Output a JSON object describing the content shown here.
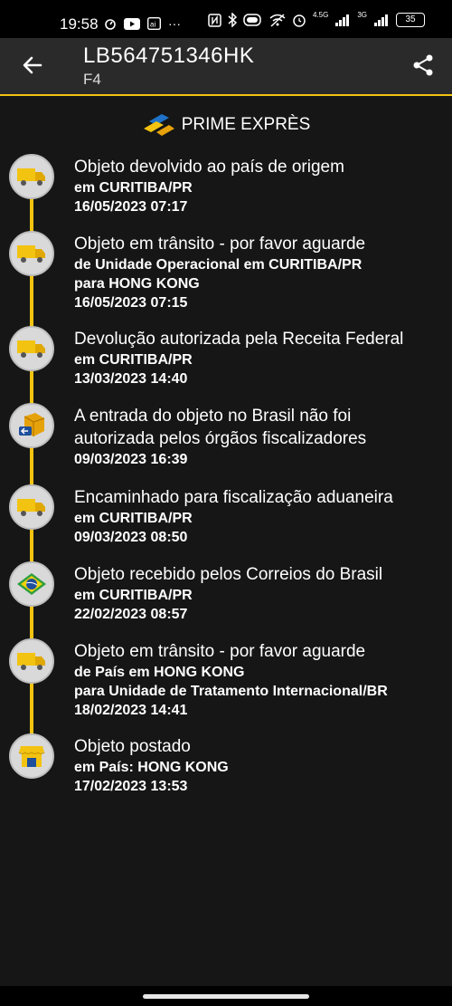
{
  "status_bar": {
    "time": "19:58",
    "network_label_1": "4.5G",
    "network_label_2": "3G",
    "battery": "35",
    "icons": [
      "timer-icon",
      "youtube-icon",
      "app-icon",
      "more-icon",
      "nfc-icon",
      "bluetooth-icon",
      "battery-saver-icon",
      "wifi-off-icon",
      "alarm-icon",
      "signal-icon",
      "signal-icon"
    ]
  },
  "header": {
    "title": "LB564751346HK",
    "subtitle": "F4",
    "back_icon": "arrow-left-icon",
    "share_icon": "share-icon",
    "accent_color": "#f2c310"
  },
  "brand": {
    "label": "PRIME EXPRÈS",
    "icon": "prime-expres-logo"
  },
  "events": [
    {
      "icon": "truck-icon",
      "title": "Objeto devolvido ao país de origem",
      "lines": [
        "em CURITIBA/PR",
        "16/05/2023 07:17"
      ]
    },
    {
      "icon": "truck-icon",
      "title": "Objeto em trânsito - por favor aguarde",
      "lines": [
        "de Unidade Operacional em CURITIBA/PR",
        "para HONG KONG",
        "16/05/2023 07:15"
      ]
    },
    {
      "icon": "truck-icon",
      "title": "Devolução autorizada pela Receita Federal",
      "lines": [
        "em CURITIBA/PR",
        "13/03/2023 14:40"
      ]
    },
    {
      "icon": "package-return-icon",
      "title": "A entrada do objeto no Brasil não foi",
      "title2": "autorizada pelos órgãos fiscalizadores",
      "lines": [
        "09/03/2023 16:39"
      ]
    },
    {
      "icon": "truck-icon",
      "title": "Encaminhado para fiscalização aduaneira",
      "lines": [
        "em CURITIBA/PR",
        "09/03/2023 08:50"
      ]
    },
    {
      "icon": "brazil-flag-icon",
      "title": "Objeto recebido pelos Correios do Brasil",
      "lines": [
        "em CURITIBA/PR",
        "22/02/2023 08:57"
      ]
    },
    {
      "icon": "truck-icon",
      "title": "Objeto em trânsito - por favor aguarde",
      "lines": [
        "de País em HONG KONG",
        "para Unidade de Tratamento Internacional/BR",
        "18/02/2023 14:41"
      ]
    },
    {
      "icon": "post-office-icon",
      "title": "Objeto postado",
      "lines": [
        "em País: HONG KONG",
        "17/02/2023 13:53"
      ]
    }
  ]
}
